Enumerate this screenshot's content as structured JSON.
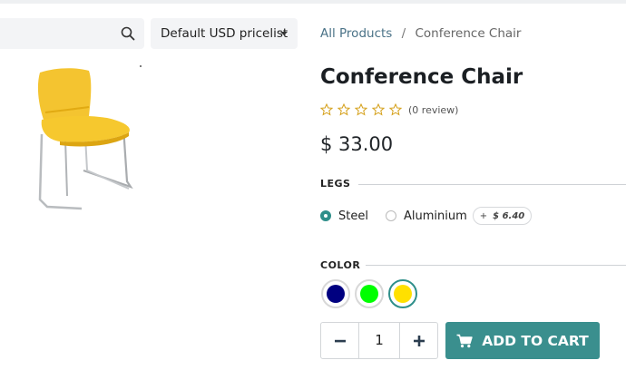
{
  "toolbar": {
    "pricelist_label": "Default USD pricelist"
  },
  "breadcrumb": {
    "parent": "All Products",
    "separator": "/",
    "current": "Conference Chair"
  },
  "product": {
    "name": "Conference Chair",
    "rating": 0,
    "review_text": "(0 review)",
    "price": "$ 33.00"
  },
  "legs": {
    "label": "LEGS",
    "options": [
      {
        "label": "Steel",
        "selected": true
      },
      {
        "label": "Aluminium",
        "selected": false,
        "extra_prefix": "+",
        "extra_price": "$ 6.40"
      }
    ]
  },
  "color": {
    "label": "COLOR",
    "options": [
      {
        "color": "#000080",
        "selected": false
      },
      {
        "color": "#00ff00",
        "selected": false
      },
      {
        "color": "#ffe000",
        "selected": true
      }
    ]
  },
  "cart": {
    "quantity": "1",
    "minus_symbol": "−",
    "plus_symbol": "+",
    "add_label": "ADD TO CART"
  },
  "colors": {
    "accent": "#3a8f8e",
    "link": "#4a7287",
    "chair": "#f4c430"
  },
  "icons": {
    "search": "search-icon",
    "caret": "caret-down-icon",
    "star": "star-outline-icon",
    "cart": "shopping-cart-icon",
    "minus": "minus-icon",
    "plus": "plus-icon"
  }
}
